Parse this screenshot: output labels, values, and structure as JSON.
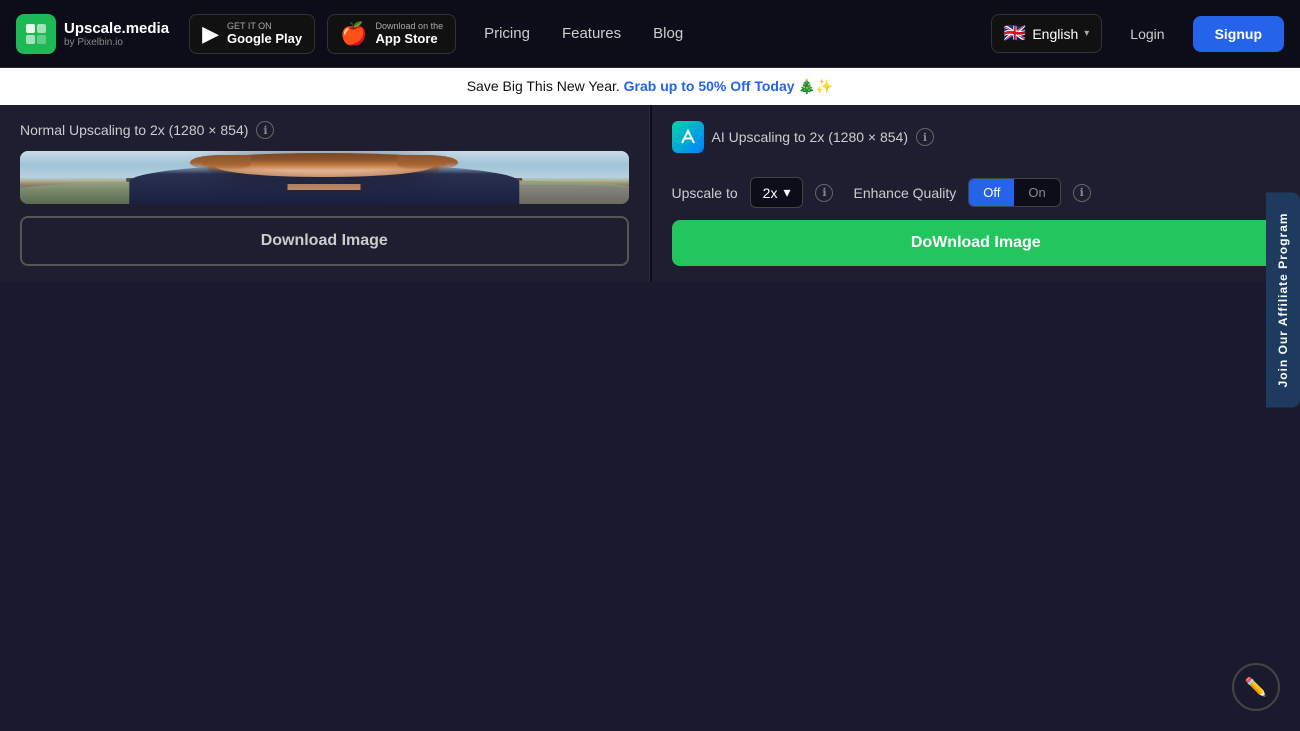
{
  "navbar": {
    "logo_main": "Upscale.media",
    "logo_sub": "by Pixelbin.io",
    "google_play_small": "GET IT ON",
    "google_play_large": "Google Play",
    "app_store_small": "Download on the",
    "app_store_large": "App Store",
    "nav_links": [
      {
        "id": "pricing",
        "label": "Pricing"
      },
      {
        "id": "features",
        "label": "Features"
      },
      {
        "id": "blog",
        "label": "Blog"
      }
    ],
    "language": "English",
    "language_flag": "🇬🇧",
    "login_label": "Login",
    "signup_label": "Signup"
  },
  "promo_banner": {
    "text": "Save Big This New Year.",
    "link_text": "Grab up to 50% Off Today 🎄✨"
  },
  "left_panel": {
    "title": "Normal Upscaling to 2x (1280 × 854)",
    "download_button": "Download Image"
  },
  "right_panel": {
    "title": "AI Upscaling to 2x (1280 × 854)",
    "upscale_label": "Upscale to",
    "scale_value": "2x",
    "enhance_label": "Enhance Quality",
    "toggle_off": "Off",
    "toggle_on": "On",
    "download_button": "DoWnload Image"
  },
  "affiliate": {
    "label": "Join Our Affiliate Program"
  },
  "icons": {
    "info": "ℹ",
    "chevron_down": "▾",
    "chat": "✏",
    "google_play_icon": "▶",
    "apple_icon": ""
  },
  "colors": {
    "accent_blue": "#2563eb",
    "accent_green": "#22c55e",
    "nav_bg": "#0d0d1a",
    "panel_bg": "#1e1e30",
    "toggle_active": "#2563eb"
  }
}
